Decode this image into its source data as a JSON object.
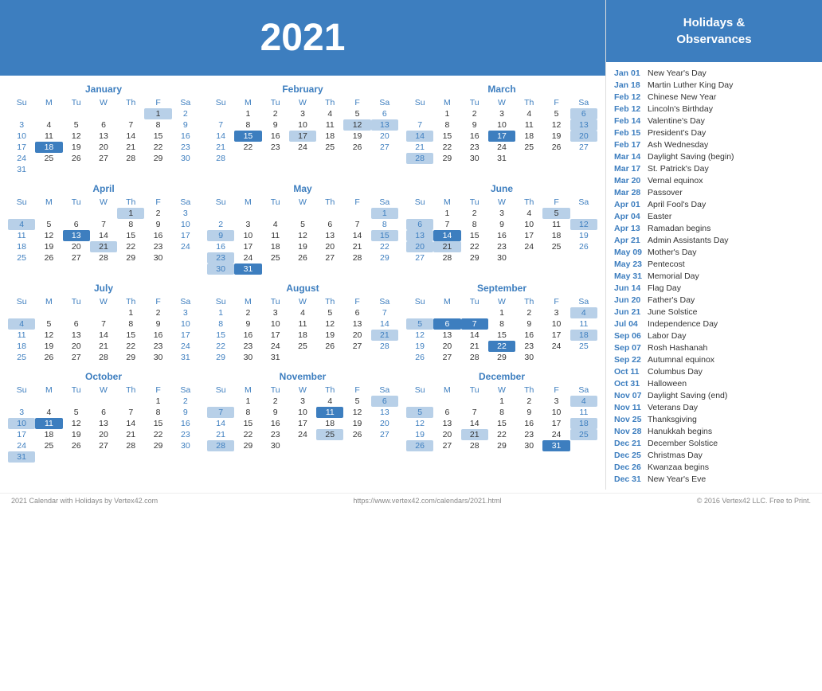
{
  "year": "2021",
  "sidebar": {
    "header": "Holidays &\nObservances",
    "holidays": [
      {
        "date": "Jan 01",
        "name": "New Year's Day"
      },
      {
        "date": "Jan 18",
        "name": "Martin Luther King Day"
      },
      {
        "date": "Feb 12",
        "name": "Chinese New Year"
      },
      {
        "date": "Feb 12",
        "name": "Lincoln's Birthday"
      },
      {
        "date": "Feb 14",
        "name": "Valentine's Day"
      },
      {
        "date": "Feb 15",
        "name": "President's Day"
      },
      {
        "date": "Feb 17",
        "name": "Ash Wednesday"
      },
      {
        "date": "Mar 14",
        "name": "Daylight Saving (begin)"
      },
      {
        "date": "Mar 17",
        "name": "St. Patrick's Day"
      },
      {
        "date": "Mar 20",
        "name": "Vernal equinox"
      },
      {
        "date": "Mar 28",
        "name": "Passover"
      },
      {
        "date": "Apr 01",
        "name": "April Fool's Day"
      },
      {
        "date": "Apr 04",
        "name": "Easter"
      },
      {
        "date": "Apr 13",
        "name": "Ramadan begins"
      },
      {
        "date": "Apr 21",
        "name": "Admin Assistants Day"
      },
      {
        "date": "May 09",
        "name": "Mother's Day"
      },
      {
        "date": "May 23",
        "name": "Pentecost"
      },
      {
        "date": "May 31",
        "name": "Memorial Day"
      },
      {
        "date": "Jun 14",
        "name": "Flag Day"
      },
      {
        "date": "Jun 20",
        "name": "Father's Day"
      },
      {
        "date": "Jun 21",
        "name": "June Solstice"
      },
      {
        "date": "Jul 04",
        "name": "Independence Day"
      },
      {
        "date": "Sep 06",
        "name": "Labor Day"
      },
      {
        "date": "Sep 07",
        "name": "Rosh Hashanah"
      },
      {
        "date": "Sep 22",
        "name": "Autumnal equinox"
      },
      {
        "date": "Oct 11",
        "name": "Columbus Day"
      },
      {
        "date": "Oct 31",
        "name": "Halloween"
      },
      {
        "date": "Nov 07",
        "name": "Daylight Saving (end)"
      },
      {
        "date": "Nov 11",
        "name": "Veterans Day"
      },
      {
        "date": "Nov 25",
        "name": "Thanksgiving"
      },
      {
        "date": "Nov 28",
        "name": "Hanukkah begins"
      },
      {
        "date": "Dec 21",
        "name": "December Solstice"
      },
      {
        "date": "Dec 25",
        "name": "Christmas Day"
      },
      {
        "date": "Dec 26",
        "name": "Kwanzaa begins"
      },
      {
        "date": "Dec 31",
        "name": "New Year's Eve"
      }
    ]
  },
  "footer": {
    "left": "2021 Calendar with Holidays by Vertex42.com",
    "center": "https://www.vertex42.com/calendars/2021.html",
    "right": "© 2016 Vertex42 LLC. Free to Print."
  }
}
